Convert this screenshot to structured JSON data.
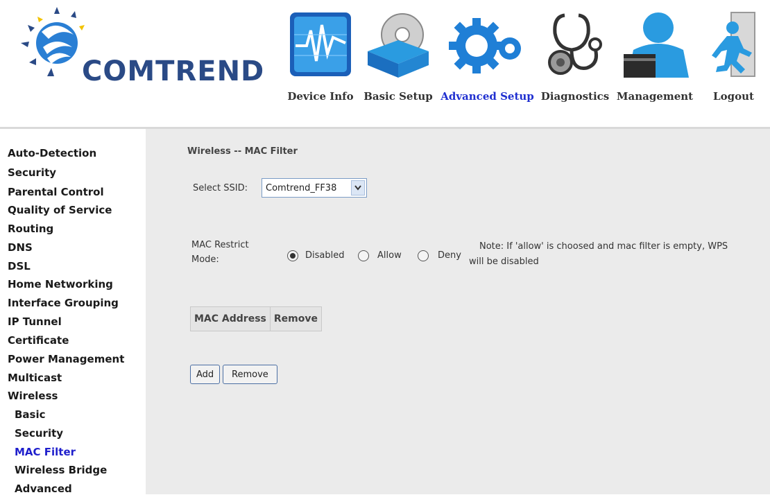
{
  "brand": {
    "logo_text": "COMTREND"
  },
  "nav": [
    {
      "label": "Device Info",
      "icon": "device-info-icon",
      "active": false
    },
    {
      "label": "Basic Setup",
      "icon": "basic-setup-icon",
      "active": false
    },
    {
      "label": "Advanced Setup",
      "icon": "advanced-setup-icon",
      "active": true
    },
    {
      "label": "Diagnostics",
      "icon": "diagnostics-icon",
      "active": false
    },
    {
      "label": "Management",
      "icon": "management-icon",
      "active": false
    },
    {
      "label": "Logout",
      "icon": "logout-icon",
      "active": false
    }
  ],
  "sidebar": {
    "items": [
      "Auto-Detection",
      "Security",
      "Parental Control",
      "Quality of Service",
      "Routing",
      "DNS",
      "DSL",
      "Home Networking",
      "Interface Grouping",
      "IP Tunnel",
      "Certificate",
      "Power Management",
      "Multicast",
      "Wireless"
    ],
    "subitems": [
      "Basic",
      "Security",
      "MAC Filter",
      "Wireless Bridge",
      "Advanced"
    ],
    "active_subitem": "MAC Filter"
  },
  "main": {
    "title": "Wireless -- MAC Filter",
    "ssid_label": "Select SSID:",
    "ssid_value": "Comtrend_FF38",
    "restrict_label_line1": "MAC Restrict",
    "restrict_label_line2": "Mode:",
    "mode_options": [
      "Disabled",
      "Allow",
      "Deny"
    ],
    "mode_selected": "Disabled",
    "note_line1": "Note: If 'allow' is choosed and mac filter is empty, WPS",
    "note_line2": "will be disabled",
    "table_headers": [
      "MAC Address",
      "Remove"
    ],
    "add_button": "Add",
    "remove_button": "Remove"
  },
  "colors": {
    "brand_blue": "#2a4a86",
    "active_nav": "#1f2fd0",
    "content_bg": "#ebebeb",
    "icon_blue": "#2a9be0"
  }
}
